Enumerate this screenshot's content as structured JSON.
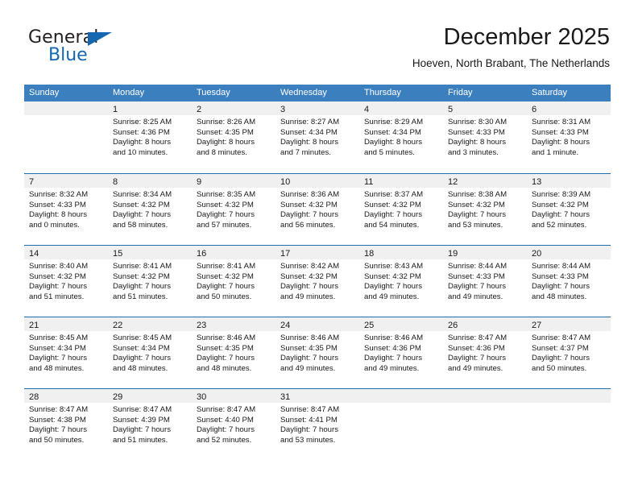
{
  "brand": {
    "word1": "General",
    "word2": "Blue",
    "accent_color": "#1667b2",
    "logo_icon": "triangle-logo-icon"
  },
  "header": {
    "title": "December 2025",
    "subtitle": "Hoeven, North Brabant, The Netherlands"
  },
  "calendar": {
    "header_bg": "#3b7fbf",
    "row_divider_color": "#1f6cb0",
    "daynum_band_bg": "#f0f0f0",
    "weekdays": [
      "Sunday",
      "Monday",
      "Tuesday",
      "Wednesday",
      "Thursday",
      "Friday",
      "Saturday"
    ],
    "weeks": [
      [
        {
          "day": "",
          "lines": []
        },
        {
          "day": "1",
          "lines": [
            "Sunrise: 8:25 AM",
            "Sunset: 4:36 PM",
            "Daylight: 8 hours",
            "and 10 minutes."
          ]
        },
        {
          "day": "2",
          "lines": [
            "Sunrise: 8:26 AM",
            "Sunset: 4:35 PM",
            "Daylight: 8 hours",
            "and 8 minutes."
          ]
        },
        {
          "day": "3",
          "lines": [
            "Sunrise: 8:27 AM",
            "Sunset: 4:34 PM",
            "Daylight: 8 hours",
            "and 7 minutes."
          ]
        },
        {
          "day": "4",
          "lines": [
            "Sunrise: 8:29 AM",
            "Sunset: 4:34 PM",
            "Daylight: 8 hours",
            "and 5 minutes."
          ]
        },
        {
          "day": "5",
          "lines": [
            "Sunrise: 8:30 AM",
            "Sunset: 4:33 PM",
            "Daylight: 8 hours",
            "and 3 minutes."
          ]
        },
        {
          "day": "6",
          "lines": [
            "Sunrise: 8:31 AM",
            "Sunset: 4:33 PM",
            "Daylight: 8 hours",
            "and 1 minute."
          ]
        }
      ],
      [
        {
          "day": "7",
          "lines": [
            "Sunrise: 8:32 AM",
            "Sunset: 4:33 PM",
            "Daylight: 8 hours",
            "and 0 minutes."
          ]
        },
        {
          "day": "8",
          "lines": [
            "Sunrise: 8:34 AM",
            "Sunset: 4:32 PM",
            "Daylight: 7 hours",
            "and 58 minutes."
          ]
        },
        {
          "day": "9",
          "lines": [
            "Sunrise: 8:35 AM",
            "Sunset: 4:32 PM",
            "Daylight: 7 hours",
            "and 57 minutes."
          ]
        },
        {
          "day": "10",
          "lines": [
            "Sunrise: 8:36 AM",
            "Sunset: 4:32 PM",
            "Daylight: 7 hours",
            "and 56 minutes."
          ]
        },
        {
          "day": "11",
          "lines": [
            "Sunrise: 8:37 AM",
            "Sunset: 4:32 PM",
            "Daylight: 7 hours",
            "and 54 minutes."
          ]
        },
        {
          "day": "12",
          "lines": [
            "Sunrise: 8:38 AM",
            "Sunset: 4:32 PM",
            "Daylight: 7 hours",
            "and 53 minutes."
          ]
        },
        {
          "day": "13",
          "lines": [
            "Sunrise: 8:39 AM",
            "Sunset: 4:32 PM",
            "Daylight: 7 hours",
            "and 52 minutes."
          ]
        }
      ],
      [
        {
          "day": "14",
          "lines": [
            "Sunrise: 8:40 AM",
            "Sunset: 4:32 PM",
            "Daylight: 7 hours",
            "and 51 minutes."
          ]
        },
        {
          "day": "15",
          "lines": [
            "Sunrise: 8:41 AM",
            "Sunset: 4:32 PM",
            "Daylight: 7 hours",
            "and 51 minutes."
          ]
        },
        {
          "day": "16",
          "lines": [
            "Sunrise: 8:41 AM",
            "Sunset: 4:32 PM",
            "Daylight: 7 hours",
            "and 50 minutes."
          ]
        },
        {
          "day": "17",
          "lines": [
            "Sunrise: 8:42 AM",
            "Sunset: 4:32 PM",
            "Daylight: 7 hours",
            "and 49 minutes."
          ]
        },
        {
          "day": "18",
          "lines": [
            "Sunrise: 8:43 AM",
            "Sunset: 4:32 PM",
            "Daylight: 7 hours",
            "and 49 minutes."
          ]
        },
        {
          "day": "19",
          "lines": [
            "Sunrise: 8:44 AM",
            "Sunset: 4:33 PM",
            "Daylight: 7 hours",
            "and 49 minutes."
          ]
        },
        {
          "day": "20",
          "lines": [
            "Sunrise: 8:44 AM",
            "Sunset: 4:33 PM",
            "Daylight: 7 hours",
            "and 48 minutes."
          ]
        }
      ],
      [
        {
          "day": "21",
          "lines": [
            "Sunrise: 8:45 AM",
            "Sunset: 4:34 PM",
            "Daylight: 7 hours",
            "and 48 minutes."
          ]
        },
        {
          "day": "22",
          "lines": [
            "Sunrise: 8:45 AM",
            "Sunset: 4:34 PM",
            "Daylight: 7 hours",
            "and 48 minutes."
          ]
        },
        {
          "day": "23",
          "lines": [
            "Sunrise: 8:46 AM",
            "Sunset: 4:35 PM",
            "Daylight: 7 hours",
            "and 48 minutes."
          ]
        },
        {
          "day": "24",
          "lines": [
            "Sunrise: 8:46 AM",
            "Sunset: 4:35 PM",
            "Daylight: 7 hours",
            "and 49 minutes."
          ]
        },
        {
          "day": "25",
          "lines": [
            "Sunrise: 8:46 AM",
            "Sunset: 4:36 PM",
            "Daylight: 7 hours",
            "and 49 minutes."
          ]
        },
        {
          "day": "26",
          "lines": [
            "Sunrise: 8:47 AM",
            "Sunset: 4:36 PM",
            "Daylight: 7 hours",
            "and 49 minutes."
          ]
        },
        {
          "day": "27",
          "lines": [
            "Sunrise: 8:47 AM",
            "Sunset: 4:37 PM",
            "Daylight: 7 hours",
            "and 50 minutes."
          ]
        }
      ],
      [
        {
          "day": "28",
          "lines": [
            "Sunrise: 8:47 AM",
            "Sunset: 4:38 PM",
            "Daylight: 7 hours",
            "and 50 minutes."
          ]
        },
        {
          "day": "29",
          "lines": [
            "Sunrise: 8:47 AM",
            "Sunset: 4:39 PM",
            "Daylight: 7 hours",
            "and 51 minutes."
          ]
        },
        {
          "day": "30",
          "lines": [
            "Sunrise: 8:47 AM",
            "Sunset: 4:40 PM",
            "Daylight: 7 hours",
            "and 52 minutes."
          ]
        },
        {
          "day": "31",
          "lines": [
            "Sunrise: 8:47 AM",
            "Sunset: 4:41 PM",
            "Daylight: 7 hours",
            "and 53 minutes."
          ]
        },
        {
          "day": "",
          "lines": []
        },
        {
          "day": "",
          "lines": []
        },
        {
          "day": "",
          "lines": []
        }
      ]
    ]
  }
}
